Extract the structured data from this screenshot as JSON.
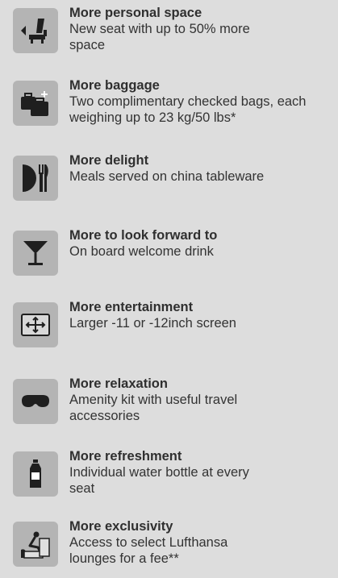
{
  "colors": {
    "background": "#dddddd",
    "icon_tile": "#b4b4b4",
    "icon_glyph": "#1f1f1f",
    "text": "#2f2f2f"
  },
  "features": [
    {
      "icon": "seat-icon",
      "title": "More personal space",
      "description": "New seat with up to 50% more space"
    },
    {
      "icon": "baggage-icon",
      "title": "More baggage",
      "description": "Two complimentary checked bags, each weighing up to 23 kg/50 lbs*"
    },
    {
      "icon": "tableware-icon",
      "title": "More delight",
      "description": "Meals served on china tableware"
    },
    {
      "icon": "cocktail-icon",
      "title": "More to look forward to",
      "description": "On board welcome drink"
    },
    {
      "icon": "screen-icon",
      "title": "More entertainment",
      "description": "Larger -11 or -12inch screen"
    },
    {
      "icon": "sleep-mask-icon",
      "title": "More relaxation",
      "description": "Amenity kit with useful travel accessories"
    },
    {
      "icon": "water-bottle-icon",
      "title": "More refreshment",
      "description": "Individual water bottle at every seat"
    },
    {
      "icon": "lounge-icon",
      "title": "More exclusivity",
      "description": "Access to select Lufthansa lounges for a fee**"
    }
  ]
}
